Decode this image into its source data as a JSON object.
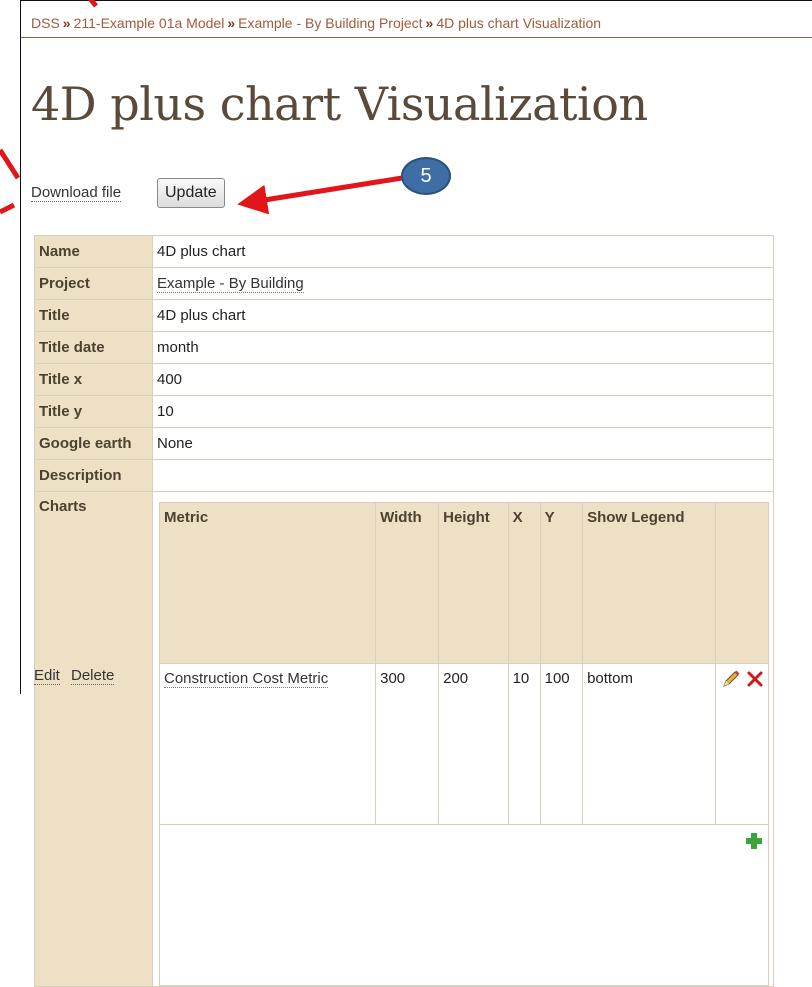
{
  "breadcrumb": {
    "items": [
      "DSS",
      "211-Example 01a Model",
      "Example - By Building Project",
      "4D plus chart Visualization"
    ],
    "separator": "»"
  },
  "page_title": "4D plus chart Visualization",
  "actions": {
    "download_label": "Download file",
    "update_label": "Update"
  },
  "details": [
    {
      "label": "Name",
      "value": "4D plus chart"
    },
    {
      "label": "Project",
      "value": "Example - By Building"
    },
    {
      "label": "Title",
      "value": "4D plus chart"
    },
    {
      "label": "Title date",
      "value": "month"
    },
    {
      "label": "Title x",
      "value": "400"
    },
    {
      "label": "Title y",
      "value": "10"
    },
    {
      "label": "Google earth",
      "value": "None"
    },
    {
      "label": "Description",
      "value": ""
    }
  ],
  "charts": {
    "label": "Charts",
    "columns": [
      "Metric",
      "Width",
      "Height",
      "X",
      "Y",
      "Show Legend"
    ],
    "rows": [
      {
        "metric": "Construction Cost Metric",
        "width": "300",
        "height": "200",
        "x": "10",
        "y": "100",
        "show_legend": "bottom"
      }
    ]
  },
  "footer": {
    "edit_label": "Edit",
    "delete_label": "Delete"
  },
  "annotation": {
    "step_number": "5",
    "arrow_color": "#e0161a",
    "badge_color": "#3d6ea6"
  },
  "icons": {
    "edit": "pencil-icon",
    "delete": "red-x-icon",
    "add": "green-plus-icon"
  }
}
